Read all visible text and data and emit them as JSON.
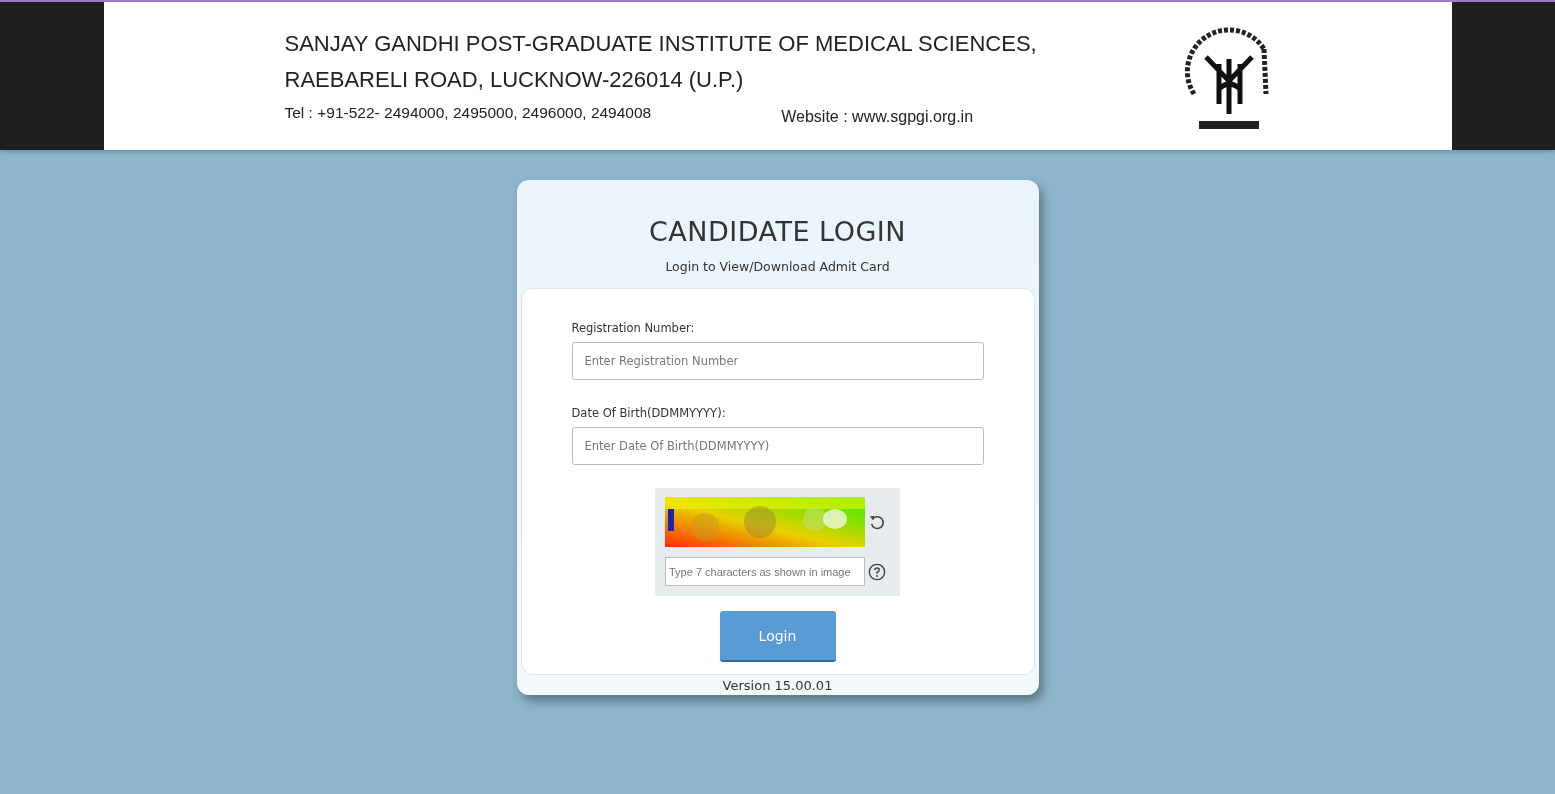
{
  "header": {
    "institute": "SANJAY GANDHI POST-GRADUATE INSTITUTE OF MEDICAL SCIENCES,",
    "address": "RAEBARELI  ROAD, LUCKNOW-226014 (U.P.)",
    "phone": "Tel : +91-522- 2494000, 2495000, 2496000, 2494008",
    "website": "Website : www.sgpgi.org.in"
  },
  "login": {
    "title": "CANDIDATE LOGIN",
    "subtitle": "Login to View/Download Admit Card",
    "fields": [
      {
        "label": "Registration Number:",
        "placeholder": "Enter Registration Number"
      },
      {
        "label": "Date Of Birth(DDMMYYYY):",
        "placeholder": "Enter Date Of Birth(DDMMYYYY)"
      }
    ],
    "captcha": {
      "kind": "picture",
      "placeholder": "Type 7 characters as shown in image"
    },
    "button": "Login",
    "version": "Version 15.00.01"
  }
}
